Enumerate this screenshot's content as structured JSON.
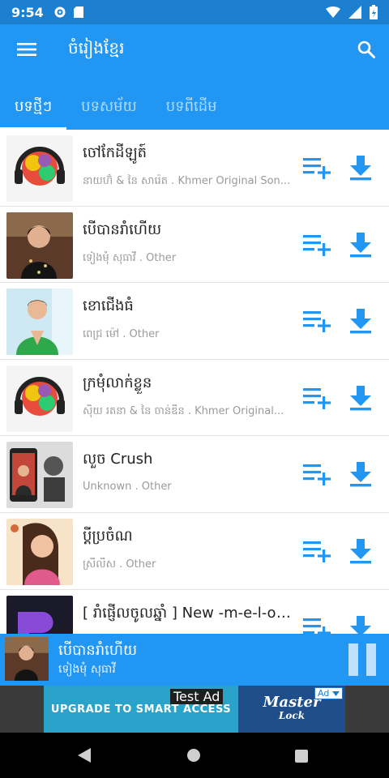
{
  "status_bar": {
    "time": "9:54"
  },
  "app_bar": {
    "title": "ចំរៀងខ្មែរ"
  },
  "tabs": [
    {
      "label": "បទថ្មីៗ",
      "active": true
    },
    {
      "label": "បទសម័យ",
      "active": false
    },
    {
      "label": "បទពីដើម",
      "active": false
    }
  ],
  "songs": [
    {
      "title": "ចៅកែដីឡូត៍",
      "subtitle": "នាយហ៊ំ & នៃ សារ៉េត . Khmer Original Son..."
    },
    {
      "title": "បើបានរាំហើយ",
      "subtitle": "ទៀងមុំ សុធាវី . Other"
    },
    {
      "title": "ខោជើងធំ",
      "subtitle": "ពេជ្រ ម៉ៅ . Other"
    },
    {
      "title": "ក្រមុំលាក់ខ្លួន",
      "subtitle": "ស៊ិយ រតនា & នៃ ចាន់ឌីន . Khmer Original..."
    },
    {
      "title": "លួច Crush",
      "subtitle": "Unknown . Other"
    },
    {
      "title": "ប្តីប្រចំណ",
      "subtitle": "ស្រីលីស . Other"
    },
    {
      "title": "[ រាំផ្ញើលចូលឆ្នាំ ] New -m-e-l-o-d...",
      "subtitle": ""
    }
  ],
  "now_playing": {
    "title": "បើបានរាំហើយ",
    "artist": "ទៀងមុំ សុធាវី"
  },
  "ad": {
    "label": "Test Ad",
    "badge": "Ad",
    "cta": "UPGRADE TO SMART ACCESS",
    "brand_line1": "Master",
    "brand_line2": "Lock"
  },
  "colors": {
    "primary": "#2196f3",
    "status_bar": "#1c7fd0",
    "icon_blue": "#2196f3"
  }
}
